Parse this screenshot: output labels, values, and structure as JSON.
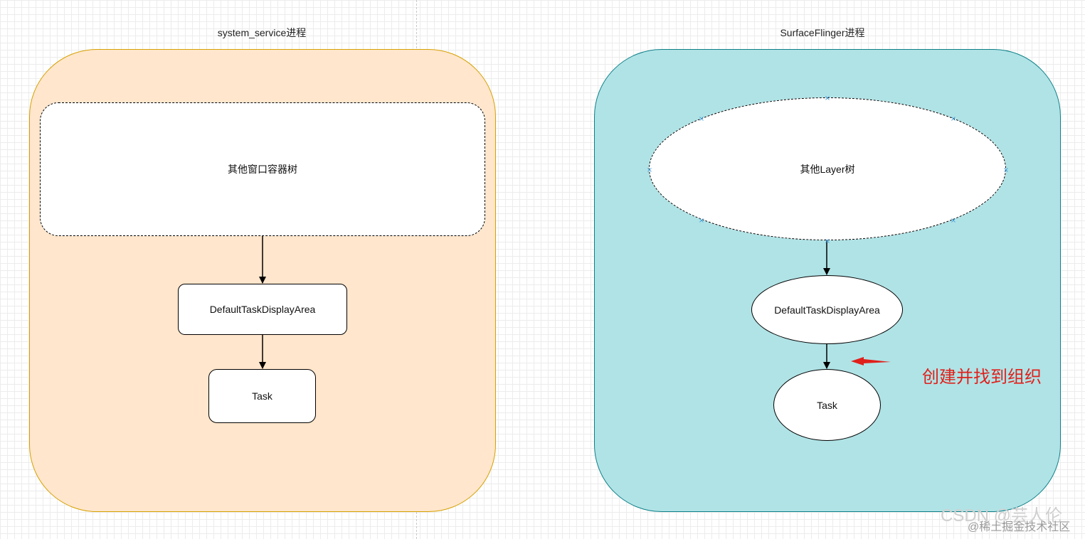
{
  "left_panel": {
    "title": "system_service进程",
    "nodes": {
      "tree": "其他窗口容器树",
      "display_area": "DefaultTaskDisplayArea",
      "task": "Task"
    }
  },
  "right_panel": {
    "title": "SurfaceFlinger进程",
    "nodes": {
      "tree": "其他Layer树",
      "display_area": "DefaultTaskDisplayArea",
      "task": "Task"
    }
  },
  "annotation": {
    "text": "创建并找到组织",
    "color": "#e0201b"
  },
  "watermark": {
    "text": "CSDN @芸人伦",
    "subtext": "@稀土掘金技术社区"
  },
  "colors": {
    "left_fill": "#ffe6cc",
    "left_stroke": "#d6a000",
    "right_fill": "#b0e3e6",
    "right_stroke": "#0e8088"
  }
}
